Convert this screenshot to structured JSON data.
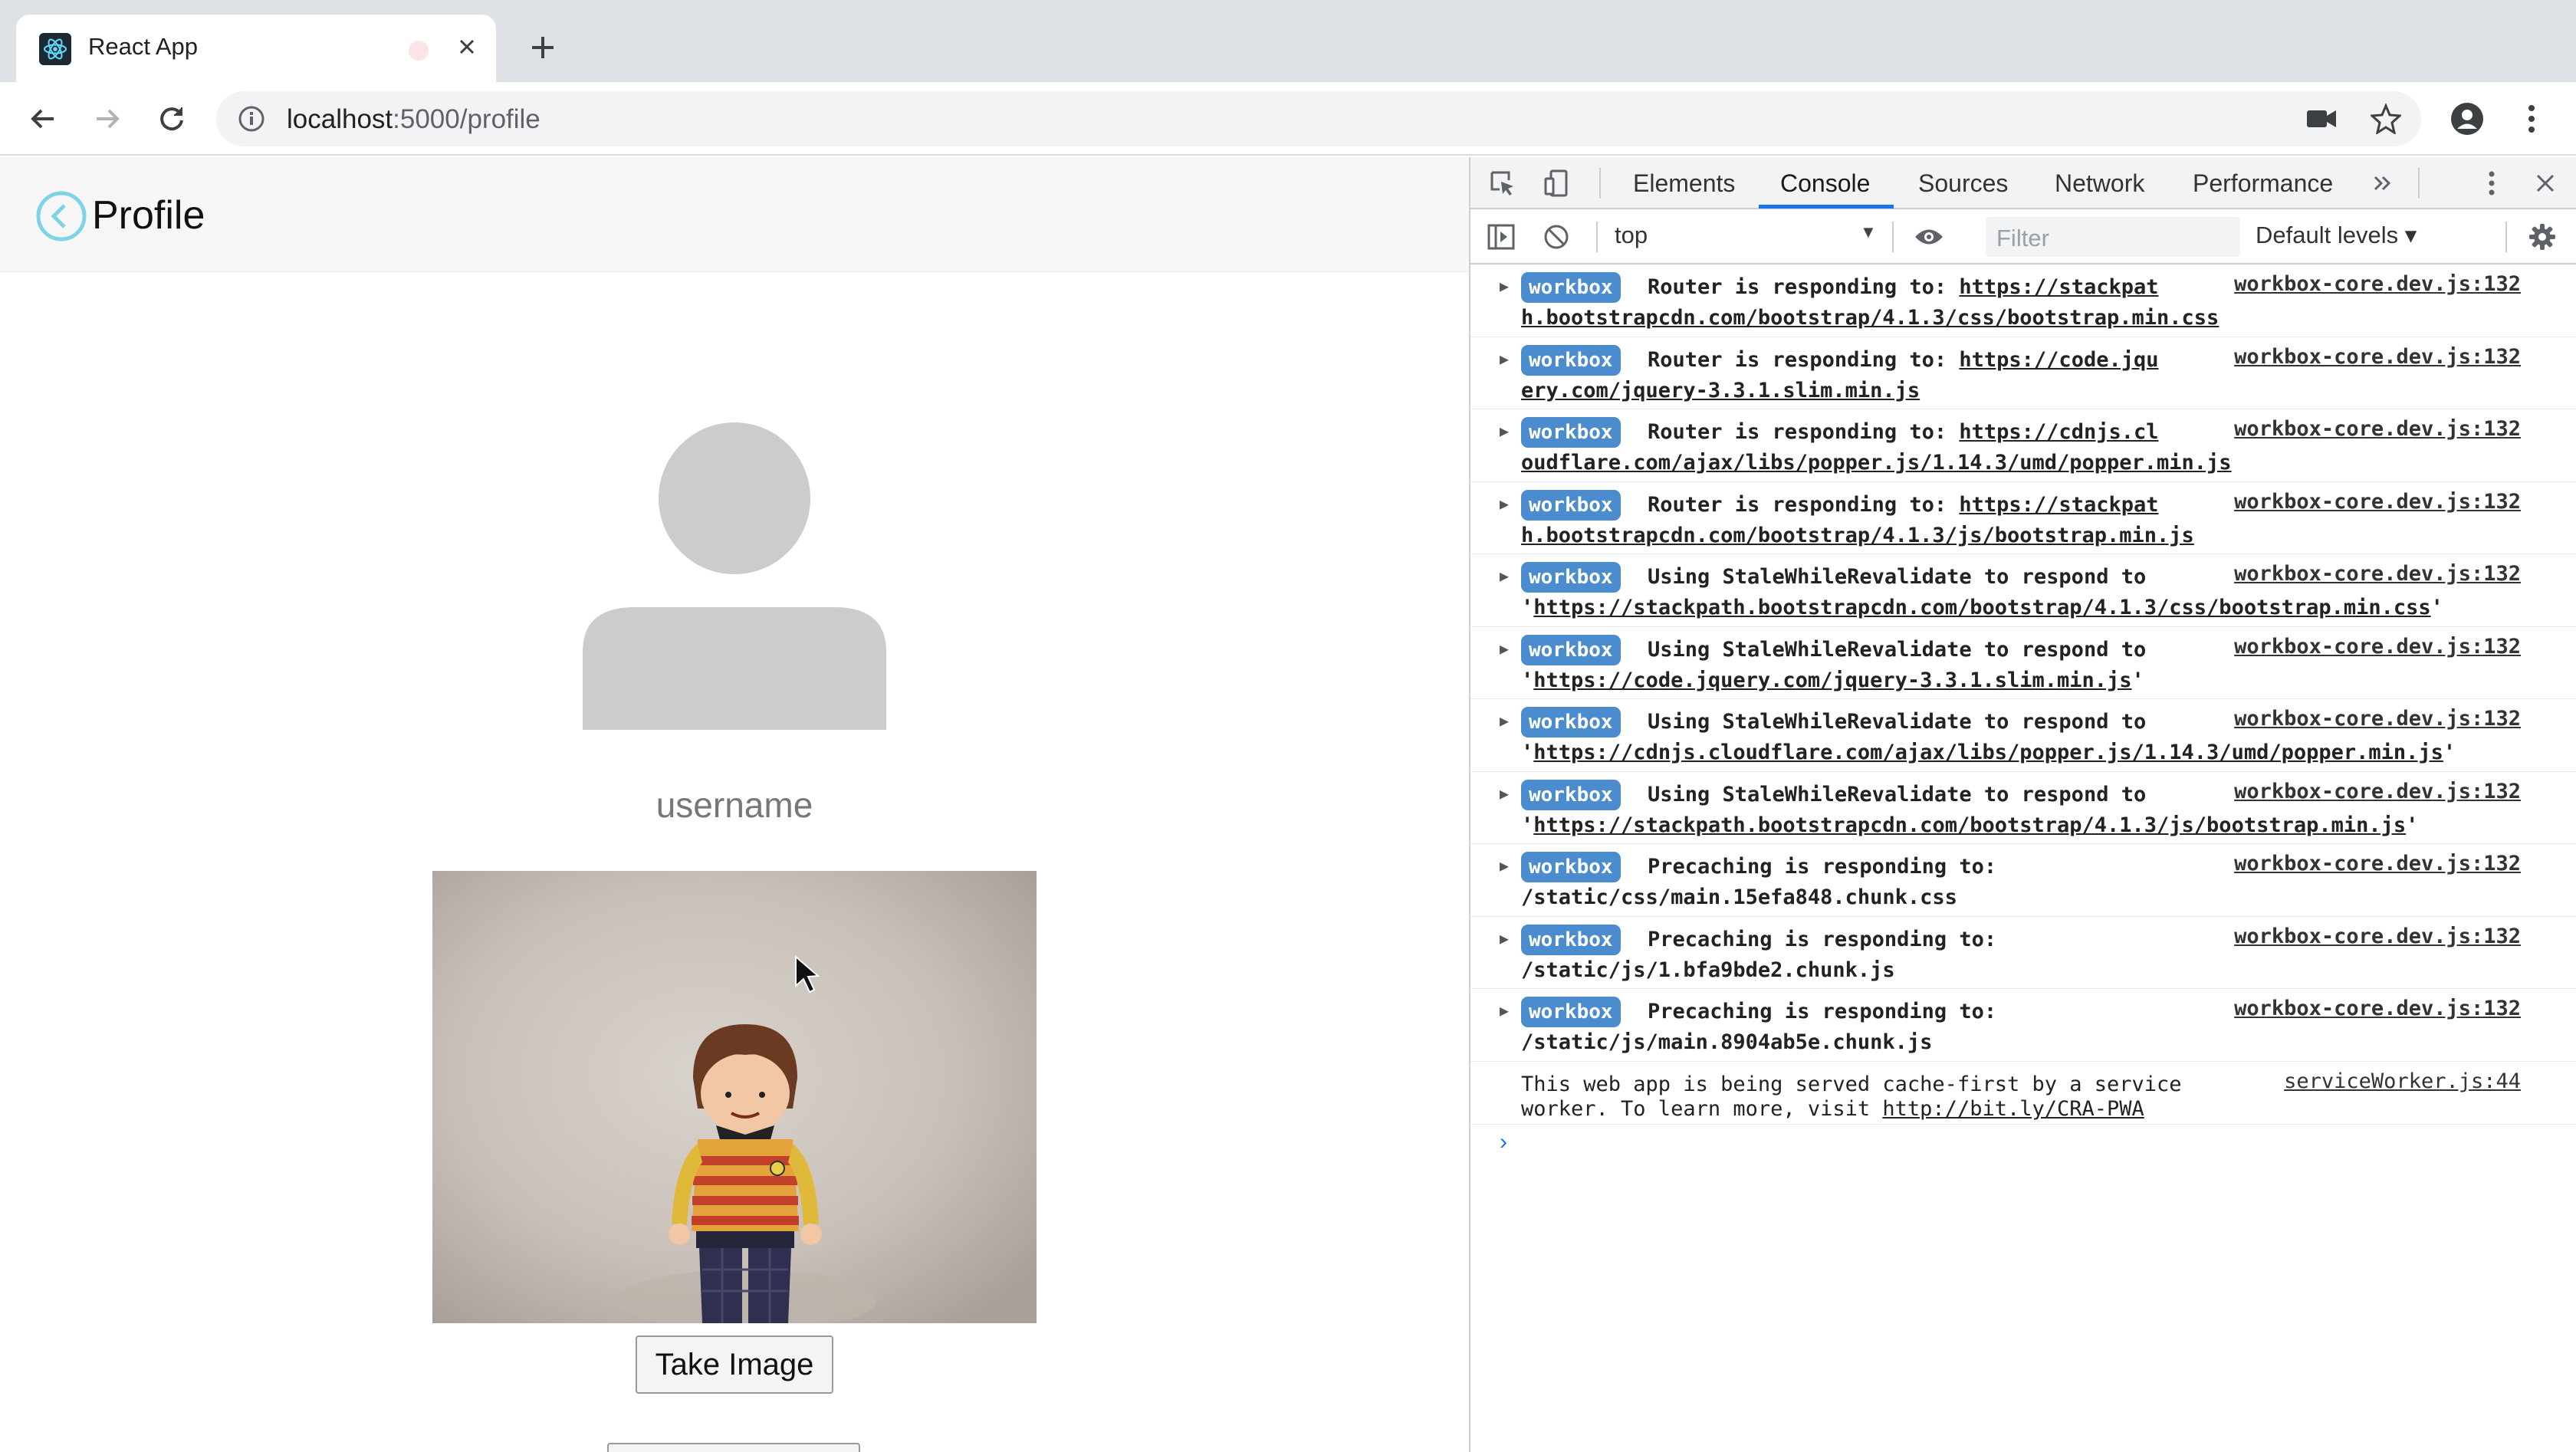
{
  "browser": {
    "tab_title": "React App",
    "url_host": "localhost",
    "url_path": ":5000/profile"
  },
  "page": {
    "title": "Profile",
    "username": "username",
    "take_image_label": "Take Image"
  },
  "devtools": {
    "tabs": [
      "Elements",
      "Console",
      "Sources",
      "Network",
      "Performance"
    ],
    "active_tab": "Console",
    "context": "top",
    "filter_placeholder": "Filter",
    "levels": "Default levels ▾",
    "messages": [
      {
        "badge": "workbox",
        "text1": "Router is responding to: ",
        "link1": "https://stackpat",
        "text2": "",
        "link2": "h.bootstrapcdn.com/bootstrap/4.1.3/css/bootstrap.min.css",
        "tail": "",
        "source": "workbox-core.dev.js:132"
      },
      {
        "badge": "workbox",
        "text1": "Router is responding to: ",
        "link1": "https://code.jqu",
        "text2": "",
        "link2": "ery.com/jquery-3.3.1.slim.min.js",
        "tail": "",
        "source": "workbox-core.dev.js:132"
      },
      {
        "badge": "workbox",
        "text1": "Router is responding to: ",
        "link1": "https://cdnjs.cl",
        "text2": "",
        "link2": "oudflare.com/ajax/libs/popper.js/1.14.3/umd/popper.min.js",
        "tail": "",
        "source": "workbox-core.dev.js:132"
      },
      {
        "badge": "workbox",
        "text1": "Router is responding to: ",
        "link1": "https://stackpat",
        "text2": "",
        "link2": "h.bootstrapcdn.com/bootstrap/4.1.3/js/bootstrap.min.js",
        "tail": "",
        "source": "workbox-core.dev.js:132"
      },
      {
        "badge": "workbox",
        "text1": "Using StaleWhileRevalidate to respond to",
        "link1": "",
        "text2": "'",
        "link2": "https://stackpath.bootstrapcdn.com/bootstrap/4.1.3/css/bootstrap.min.css",
        "tail": "'",
        "source": "workbox-core.dev.js:132"
      },
      {
        "badge": "workbox",
        "text1": "Using StaleWhileRevalidate to respond to",
        "link1": "",
        "text2": "'",
        "link2": "https://code.jquery.com/jquery-3.3.1.slim.min.js",
        "tail": "'",
        "source": "workbox-core.dev.js:132"
      },
      {
        "badge": "workbox",
        "text1": "Using StaleWhileRevalidate to respond to",
        "link1": "",
        "text2": "'",
        "link2": "https://cdnjs.cloudflare.com/ajax/libs/popper.js/1.14.3/umd/popper.min.js",
        "tail": "'",
        "source": "workbox-core.dev.js:132"
      },
      {
        "badge": "workbox",
        "text1": "Using StaleWhileRevalidate to respond to",
        "link1": "",
        "text2": "'",
        "link2": "https://stackpath.bootstrapcdn.com/bootstrap/4.1.3/js/bootstrap.min.js",
        "tail": "'",
        "source": "workbox-core.dev.js:132"
      },
      {
        "badge": "workbox",
        "text1": "Precaching is responding to:",
        "link1": "",
        "text2": "/static/css/main.15efa848.chunk.css",
        "link2": "",
        "tail": "",
        "source": "workbox-core.dev.js:132"
      },
      {
        "badge": "workbox",
        "text1": "Precaching is responding to:",
        "link1": "",
        "text2": "/static/js/1.bfa9bde2.chunk.js",
        "link2": "",
        "tail": "",
        "source": "workbox-core.dev.js:132"
      },
      {
        "badge": "workbox",
        "text1": "Precaching is responding to:",
        "link1": "",
        "text2": "/static/js/main.8904ab5e.chunk.js",
        "link2": "",
        "tail": "",
        "source": "workbox-core.dev.js:132"
      }
    ],
    "sw_message": {
      "line1": "This web app is being served cache-first by a service",
      "line2": "worker. To learn more, visit ",
      "link": "http://bit.ly/CRA-PWA",
      "source": "serviceWorker.js:44"
    }
  },
  "colors": {
    "badge": "#4a8ccd",
    "accent": "#1a73e8",
    "back_icon": "#7fd3e6"
  }
}
